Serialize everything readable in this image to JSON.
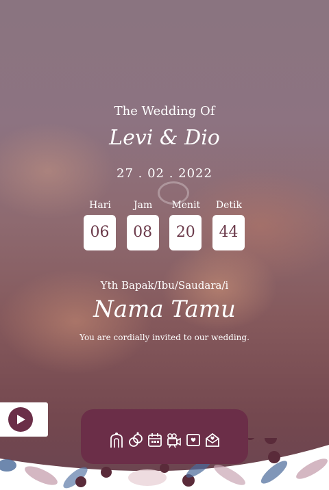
{
  "header": {
    "subtitle": "The Wedding Of",
    "couple": "Levi & Dio",
    "date": "27 . 02 . 2022"
  },
  "countdown": [
    {
      "label": "Hari",
      "value": "06"
    },
    {
      "label": "Jam",
      "value": "08"
    },
    {
      "label": "Menit",
      "value": "20"
    },
    {
      "label": "Detik",
      "value": "44"
    }
  ],
  "guest": {
    "greeting": "Yth Bapak/Ibu/Saudara/i",
    "name": "Nama Tamu",
    "invite_text": "You are cordially invited to our wedding."
  },
  "nav": {
    "icons": [
      "couple-icon",
      "rings-icon",
      "calendar-icon",
      "camera-icon",
      "gallery-icon",
      "envelope-icon"
    ]
  },
  "colors": {
    "accent": "#6b2e48",
    "text": "#ffffff",
    "countdown_text": "#6b3a4a"
  }
}
